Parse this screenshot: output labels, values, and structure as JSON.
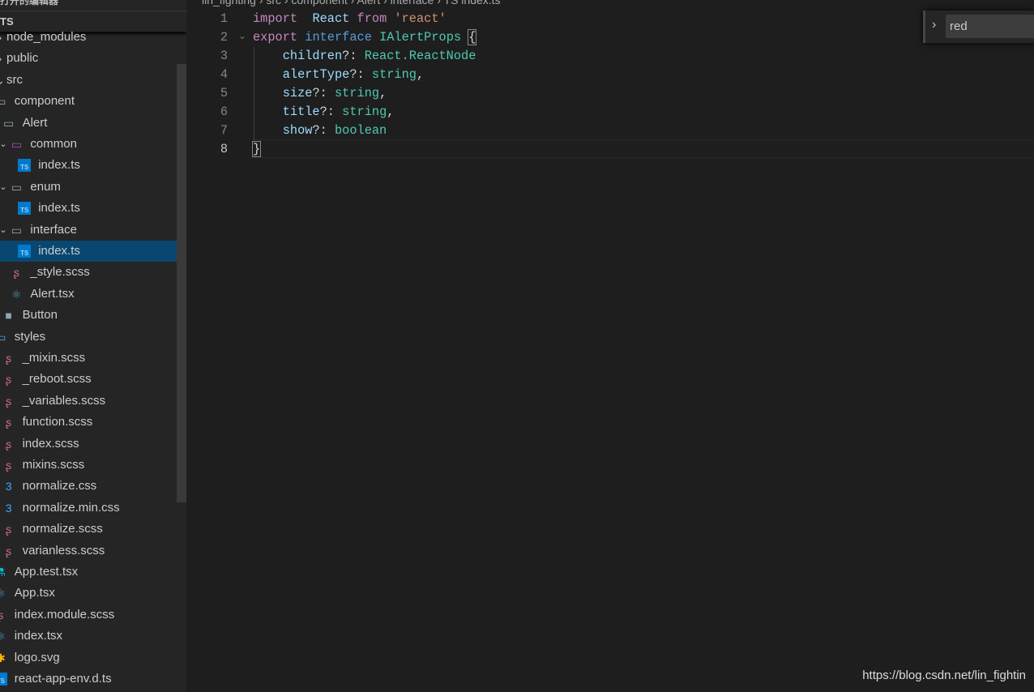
{
  "sidebar": {
    "title": "打开的编辑器",
    "header": "TS",
    "items": [
      {
        "label": "node_modules",
        "depth": 0,
        "icon": "chevron-right-icon"
      },
      {
        "label": "public",
        "depth": 0,
        "icon": "chevron-right-icon"
      },
      {
        "label": "src",
        "depth": 0,
        "icon": "chevron-down-icon"
      },
      {
        "label": "component",
        "depth": 1,
        "icon": "folder-open-icon"
      },
      {
        "label": "Alert",
        "depth": 2,
        "icon": "folder-open-icon"
      },
      {
        "label": "common",
        "depth": 3,
        "icon": "folder-common-icon",
        "chevron": true
      },
      {
        "label": "index.ts",
        "depth": 4,
        "icon": "typescript-icon"
      },
      {
        "label": "enum",
        "depth": 3,
        "icon": "folder-open-icon",
        "chevron": true
      },
      {
        "label": "index.ts",
        "depth": 4,
        "icon": "typescript-icon"
      },
      {
        "label": "interface",
        "depth": 3,
        "icon": "folder-open-icon",
        "chevron": true
      },
      {
        "label": "index.ts",
        "depth": 4,
        "icon": "typescript-icon",
        "selected": true
      },
      {
        "label": "_style.scss",
        "depth": 3,
        "icon": "sass-icon"
      },
      {
        "label": "Alert.tsx",
        "depth": 3,
        "icon": "react-icon"
      },
      {
        "label": "Button",
        "depth": 2,
        "icon": "folder-icon"
      },
      {
        "label": "styles",
        "depth": 1,
        "icon": "folder-styles-icon"
      },
      {
        "label": "_mixin.scss",
        "depth": 2,
        "icon": "sass-icon"
      },
      {
        "label": "_reboot.scss",
        "depth": 2,
        "icon": "sass-icon"
      },
      {
        "label": "_variables.scss",
        "depth": 2,
        "icon": "sass-icon"
      },
      {
        "label": "function.scss",
        "depth": 2,
        "icon": "sass-icon"
      },
      {
        "label": "index.scss",
        "depth": 2,
        "icon": "sass-icon"
      },
      {
        "label": "mixins.scss",
        "depth": 2,
        "icon": "sass-icon"
      },
      {
        "label": "normalize.css",
        "depth": 2,
        "icon": "css-icon"
      },
      {
        "label": "normalize.min.css",
        "depth": 2,
        "icon": "css-icon"
      },
      {
        "label": "normalize.scss",
        "depth": 2,
        "icon": "sass-icon"
      },
      {
        "label": "varianless.scss",
        "depth": 2,
        "icon": "sass-icon"
      },
      {
        "label": "App.test.tsx",
        "depth": 1,
        "icon": "test-flask-icon"
      },
      {
        "label": "App.tsx",
        "depth": 1,
        "icon": "react-icon"
      },
      {
        "label": "index.module.scss",
        "depth": 1,
        "icon": "sass-icon"
      },
      {
        "label": "index.tsx",
        "depth": 1,
        "icon": "react-icon"
      },
      {
        "label": "logo.svg",
        "depth": 1,
        "icon": "svg-icon"
      },
      {
        "label": "react-app-env.d.ts",
        "depth": 1,
        "icon": "typescript-icon"
      }
    ]
  },
  "editor": {
    "breadcrumb": "lin_fighting › src › component › Alert › interface › TS index.ts",
    "current_line": 8,
    "lines": [
      [
        [
          "kw",
          "import"
        ],
        [
          "",
          "  "
        ],
        [
          "id",
          "React"
        ],
        [
          "",
          " "
        ],
        [
          "kw",
          "from"
        ],
        [
          "",
          " "
        ],
        [
          "st",
          "'react'"
        ]
      ],
      [
        [
          "kw",
          "export"
        ],
        [
          "",
          " "
        ],
        [
          "k2",
          "interface"
        ],
        [
          "",
          " "
        ],
        [
          "ty",
          "IAlertProps"
        ],
        [
          "",
          " "
        ],
        [
          "br",
          "{"
        ]
      ],
      [
        [
          "",
          "    "
        ],
        [
          "id",
          "children"
        ],
        [
          "",
          "?: "
        ],
        [
          "ty",
          "React.ReactNode"
        ]
      ],
      [
        [
          "",
          "    "
        ],
        [
          "id",
          "alertType"
        ],
        [
          "",
          "?: "
        ],
        [
          "ty",
          "string"
        ],
        [
          "",
          ","
        ]
      ],
      [
        [
          "",
          "    "
        ],
        [
          "id",
          "size"
        ],
        [
          "",
          "?: "
        ],
        [
          "ty",
          "string"
        ],
        [
          "",
          ","
        ]
      ],
      [
        [
          "",
          "    "
        ],
        [
          "id",
          "title"
        ],
        [
          "",
          "?: "
        ],
        [
          "ty",
          "string"
        ],
        [
          "",
          ","
        ]
      ],
      [
        [
          "",
          "    "
        ],
        [
          "id",
          "show"
        ],
        [
          "",
          "?: "
        ],
        [
          "ty",
          "boolean"
        ]
      ],
      [
        [
          "br",
          "}"
        ]
      ]
    ]
  },
  "find": {
    "value": "red"
  },
  "watermark": "https://blog.csdn.net/lin_fightin",
  "colors": {
    "sidebar": "#252526",
    "editor": "#1e1e1e",
    "selection": "#094771",
    "sass": "#cd6799",
    "ts": "#007acc",
    "react": "#519aba"
  }
}
